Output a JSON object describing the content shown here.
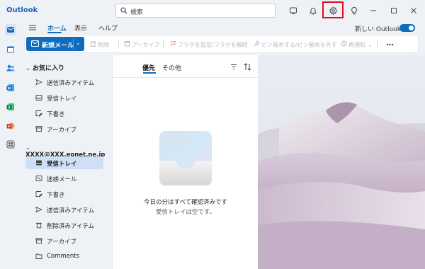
{
  "app": {
    "title": "Outlook"
  },
  "search": {
    "placeholder": "検索"
  },
  "ribbon": {
    "tabs": [
      {
        "label": "ホーム",
        "active": true
      },
      {
        "label": "表示",
        "active": false
      },
      {
        "label": "ヘルプ",
        "active": false
      }
    ],
    "new_outlook_label": "新しい Outlook",
    "new_outlook_on": true,
    "new_mail_label": "新規メール",
    "commands": [
      {
        "label": "削除",
        "icon": "trash-icon"
      },
      {
        "label": "アーカイブ",
        "icon": "archive-icon"
      },
      {
        "label": "フラグを設定/フラグを解除",
        "icon": "flag-icon"
      },
      {
        "label": "ピン留めする/ピン留めを外す",
        "icon": "pin-icon"
      },
      {
        "label": "再通知",
        "icon": "clock-icon"
      }
    ],
    "more_label": "…"
  },
  "folders": {
    "favorites_label": "お気に入り",
    "favorites": [
      {
        "label": "送信済みアイテム",
        "icon": "send-icon"
      },
      {
        "label": "受信トレイ",
        "icon": "inbox-icon"
      },
      {
        "label": "下書き",
        "icon": "draft-icon"
      },
      {
        "label": "アーカイブ",
        "icon": "archive-icon"
      }
    ],
    "account_label": "XXXX@XXX.eonet.ne.jp",
    "account_folders": [
      {
        "label": "受信トレイ",
        "icon": "inbox-icon",
        "selected": true
      },
      {
        "label": "迷惑メール",
        "icon": "junk-icon"
      },
      {
        "label": "下書き",
        "icon": "draft-icon"
      },
      {
        "label": "送信済みアイテム",
        "icon": "send-icon"
      },
      {
        "label": "削除済みアイテム",
        "icon": "trash-icon"
      },
      {
        "label": "アーカイブ",
        "icon": "archive-icon"
      },
      {
        "label": "Comments",
        "icon": "folder-icon"
      }
    ]
  },
  "message_list": {
    "tabs": [
      {
        "label": "優先",
        "active": true
      },
      {
        "label": "その他",
        "active": false
      }
    ],
    "empty_title": "今日の分はすべて確認済みです",
    "empty_subtitle": "受信トレイは空です。"
  },
  "colors": {
    "accent": "#0f6cbd",
    "highlight_box": "#e0101a",
    "selected_folder": "#cfe0f6"
  }
}
